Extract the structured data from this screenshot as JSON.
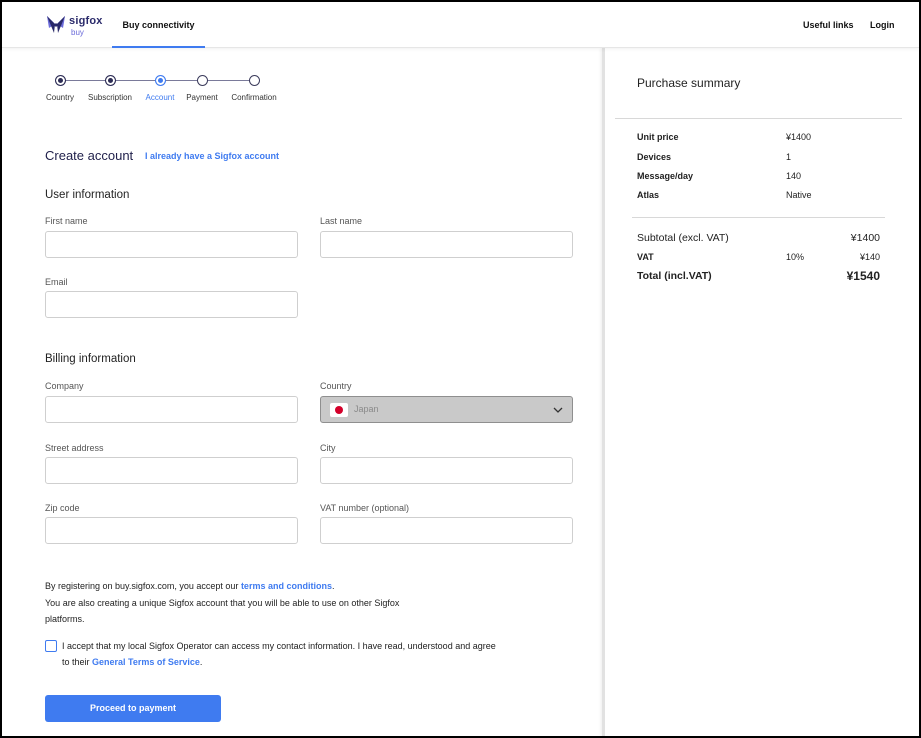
{
  "brand": {
    "name": "sigfox",
    "sub": "buy"
  },
  "nav": {
    "tab": "Buy connectivity",
    "useful_links": "Useful links",
    "login": "Login"
  },
  "steps": [
    {
      "label": "Country",
      "state": "done"
    },
    {
      "label": "Subscription",
      "state": "done"
    },
    {
      "label": "Account",
      "state": "current"
    },
    {
      "label": "Payment",
      "state": "todo"
    },
    {
      "label": "Confirmation",
      "state": "todo"
    }
  ],
  "account": {
    "title": "Create account",
    "have_account_link": "I already have a Sigfox account"
  },
  "user_info": {
    "title": "User information",
    "first_name_label": "First name",
    "first_name_value": "",
    "last_name_label": "Last name",
    "last_name_value": "",
    "email_label": "Email",
    "email_value": ""
  },
  "billing": {
    "title": "Billing information",
    "company_label": "Company",
    "company_value": "",
    "country_label": "Country",
    "country_value": "Japan",
    "street_label": "Street address",
    "street_value": "",
    "city_label": "City",
    "city_value": "",
    "zip_label": "Zip code",
    "zip_value": "",
    "vat_label": "VAT number (optional)",
    "vat_value": ""
  },
  "legal": {
    "line1_prefix": "By registering on buy.sigfox.com, you accept our ",
    "terms_link": "terms and conditions",
    "line1_suffix": ".",
    "line2": "You are also creating a unique Sigfox account that you will be able to use on other Sigfox",
    "line3": "platforms."
  },
  "consent": {
    "line1": "I accept that my local Sigfox Operator can access my contact information. I have read, understood and agree",
    "line2_prefix": "to their ",
    "tos_link": "General Terms of Service",
    "line2_suffix": ".",
    "checked": false
  },
  "proceed_button": "Proceed to payment",
  "summary": {
    "title": "Purchase summary",
    "items": [
      {
        "label": "Unit price",
        "value": "¥1400"
      },
      {
        "label": "Devices",
        "value": "1"
      },
      {
        "label": "Message/day",
        "value": "140"
      },
      {
        "label": "Atlas",
        "value": "Native"
      }
    ],
    "subtotal_label": "Subtotal (excl. VAT)",
    "subtotal_value": "¥1400",
    "vat_label": "VAT",
    "vat_rate": "10%",
    "vat_value": "¥140",
    "total_label": "Total (incl.VAT)",
    "total_value": "¥1540"
  },
  "colors": {
    "accent": "#3f7bf0",
    "navy": "#2d2d55",
    "select_bg": "#c9c9c9",
    "flag_red": "#d4002a"
  },
  "icons": [
    "sigfox-butterfly-icon",
    "japan-flag-icon",
    "chevron-down-icon",
    "checkbox-icon"
  ]
}
